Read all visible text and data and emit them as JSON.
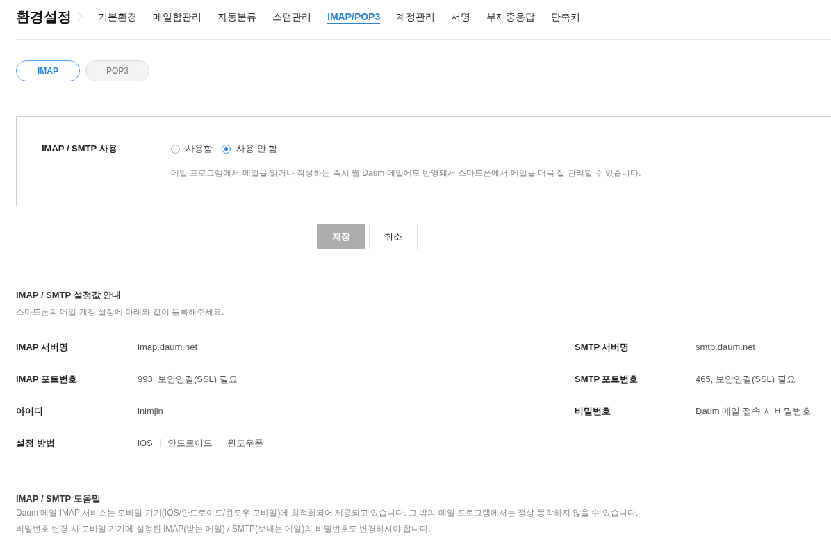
{
  "header": {
    "title": "환경설정",
    "tabs": [
      {
        "label": "기본환경",
        "selected": false
      },
      {
        "label": "메일함관리",
        "selected": false
      },
      {
        "label": "자동분류",
        "selected": false
      },
      {
        "label": "스팸관리",
        "selected": false
      },
      {
        "label": "IMAP/POP3",
        "selected": true
      },
      {
        "label": "계정관리",
        "selected": false
      },
      {
        "label": "서명",
        "selected": false
      },
      {
        "label": "부재중응답",
        "selected": false
      },
      {
        "label": "단축키",
        "selected": false
      }
    ]
  },
  "protocol_tabs": [
    {
      "label": "IMAP",
      "selected": true
    },
    {
      "label": "POP3",
      "selected": false
    }
  ],
  "usage_setting": {
    "label": "IMAP / SMTP 사용",
    "options": [
      {
        "label": "사용함",
        "selected": false
      },
      {
        "label": "사용 안 함",
        "selected": true
      }
    ],
    "description": "메일 프로그램에서 메일을 읽거나 작성하는 즉시 웹 Daum 메일에도 반영돼서 스마트폰에서 메일을 더욱 잘 관리할 수 있습니다."
  },
  "buttons": [
    {
      "label": "저장",
      "disabled": true
    },
    {
      "label": "취소",
      "disabled": false
    }
  ],
  "settings_info": {
    "title": "IMAP / SMTP 설정값 안내",
    "subtitle": "스마트폰의 메일 계정 설정에 아래와 같이 등록해주세요.",
    "rows": [
      {
        "cells": [
          {
            "kind": "text",
            "label": "IMAP 서버명",
            "value": "imap.daum.net"
          },
          {
            "kind": "text",
            "label": "SMTP 서버명",
            "value": "smtp.daum.net"
          }
        ]
      },
      {
        "cells": [
          {
            "kind": "text",
            "label": "IMAP 포트번호",
            "value": "993, 보안연결(SSL) 필요"
          },
          {
            "kind": "text",
            "label": "SMTP 포트번호",
            "value": "465, 보안연결(SSL) 필요"
          }
        ]
      },
      {
        "cells": [
          {
            "kind": "text",
            "label": "아이디",
            "value": "inimjin"
          },
          {
            "kind": "text",
            "label": "비밀번호",
            "value": "Daum 메일 접속 시 비밀번호"
          }
        ]
      },
      {
        "cells": [
          {
            "kind": "links",
            "label": "설정 방법",
            "links": [
              "iOS",
              "안드로이드",
              "윈도우폰"
            ]
          }
        ]
      }
    ]
  },
  "help": {
    "title": "IMAP / SMTP 도움말",
    "lines": [
      "Daum 메일 IMAP 서비스는 모바일 기기(IOS/안드로이드/윈도우 모바일)에 최적화되어 제공되고 있습니다. 그 밖의 메일 프로그램에서는 정상 동작하지 않을 수 있습니다.",
      "비밀번호 변경 시 모바일 기기에 설정된 IMAP(받는 메일) / SMTP(보내는 메일)의 비밀번호도 변경하셔야 합니다."
    ]
  }
}
